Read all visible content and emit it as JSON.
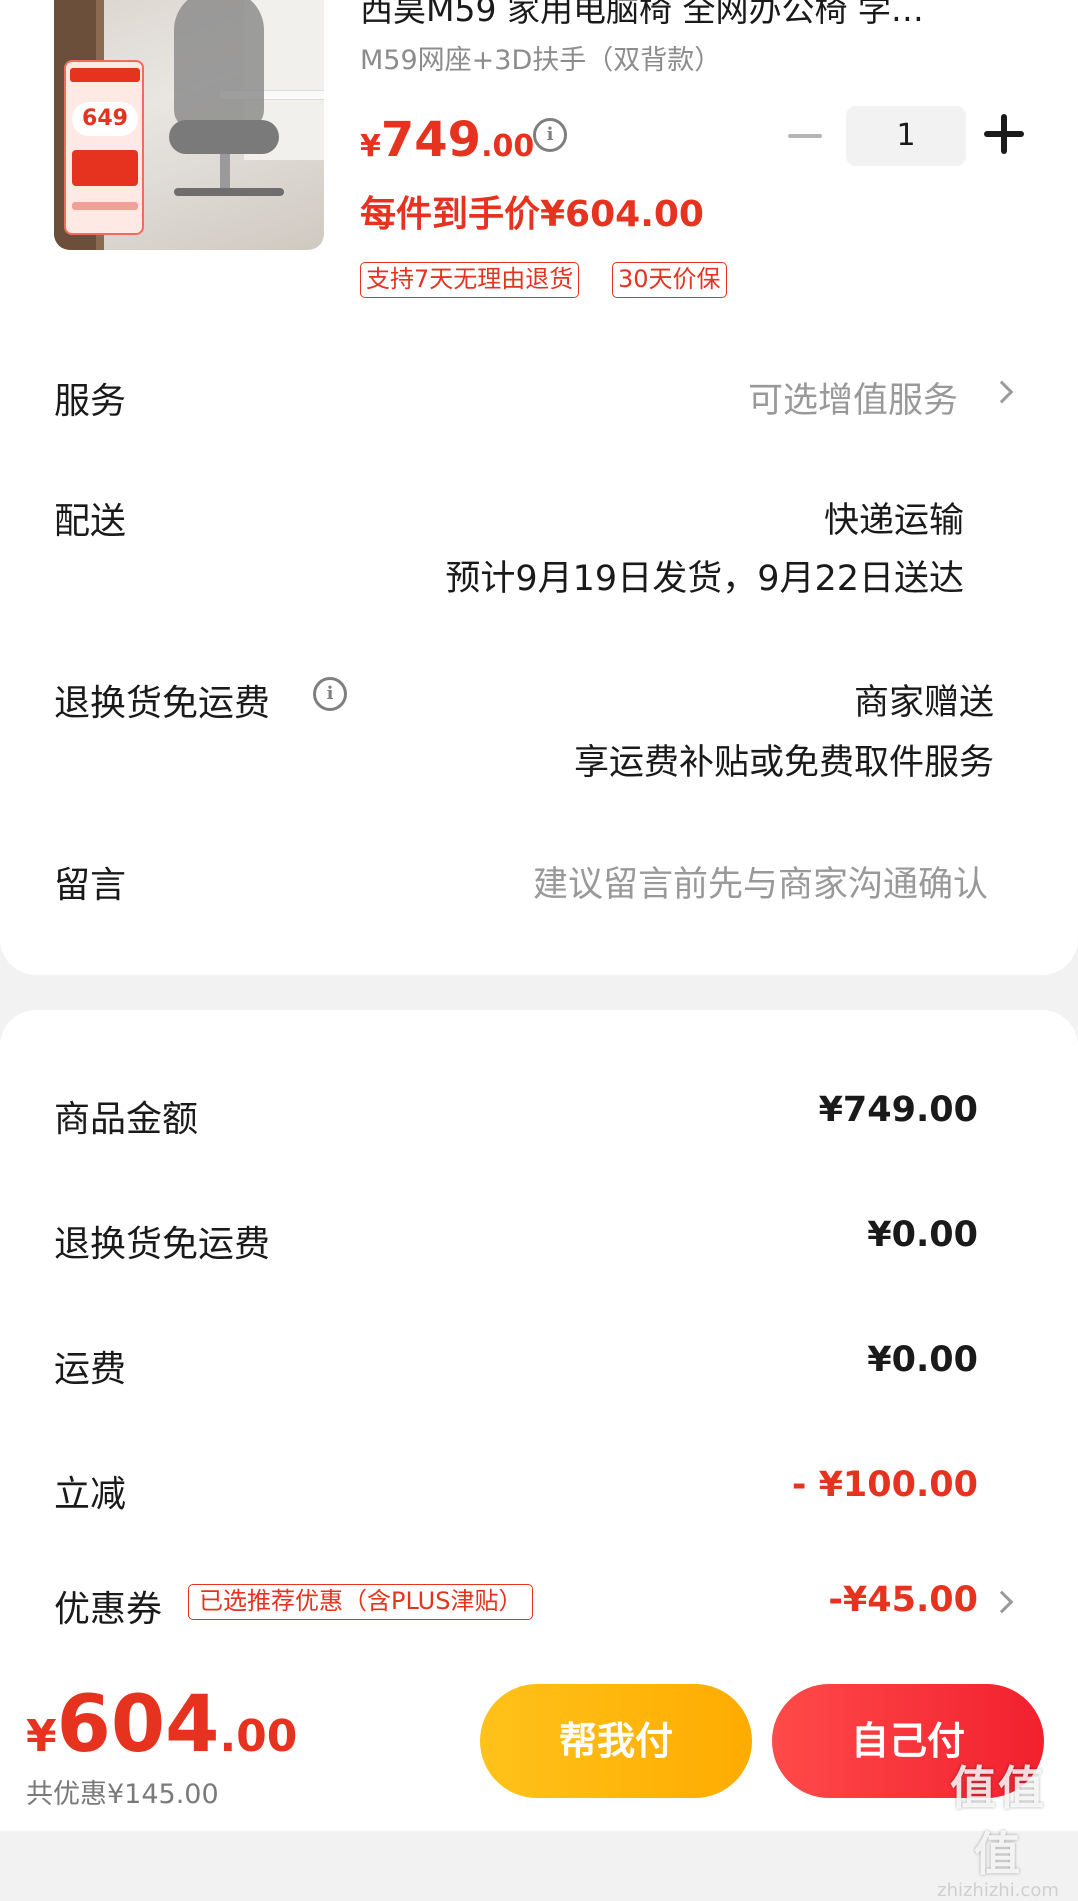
{
  "product": {
    "title": "西昊M59 家用电脑椅 全网办公椅 学…",
    "spec": "M59网座+3D扶手（双背款）",
    "price_currency": "¥",
    "price_int": "749",
    "price_dec": ".00",
    "quantity": "1",
    "final_price_text": "每件到手价¥604.00",
    "tags": [
      "支持7天无理由退货",
      "30天价保"
    ],
    "image_badge_price": "649"
  },
  "rows": {
    "service_label": "服务",
    "service_value": "可选增值服务",
    "delivery_label": "配送",
    "delivery_method": "快递运输",
    "delivery_eta": "预计9月19日发货，9月22日送达",
    "return_label": "退换货免运费",
    "return_value": "商家赠送",
    "return_desc": "享运费补贴或免费取件服务",
    "note_label": "留言",
    "note_placeholder": "建议留言前先与商家沟通确认"
  },
  "summary": {
    "goods_label": "商品金额",
    "goods_value": "¥749.00",
    "return_fee_label": "退换货免运费",
    "return_fee_value": "¥0.00",
    "shipping_label": "运费",
    "shipping_value": "¥0.00",
    "discount_label": "立减",
    "discount_value": "- ¥100.00",
    "coupon_label": "优惠券",
    "coupon_chip": "已选推荐优惠（含PLUS津贴）",
    "coupon_value": "-¥45.00"
  },
  "footer": {
    "total_currency": "¥",
    "total_int": "604",
    "total_dec": ".00",
    "saved_text": "共优惠¥145.00",
    "help_pay_label": "帮我付",
    "self_pay_label": "自己付",
    "watermark_main": "值值值",
    "watermark_sub": "zhizhizhi.com"
  },
  "colors": {
    "accent_red": "#e6331f",
    "help_button": "#ffb30f",
    "self_button": "#f32a38"
  }
}
